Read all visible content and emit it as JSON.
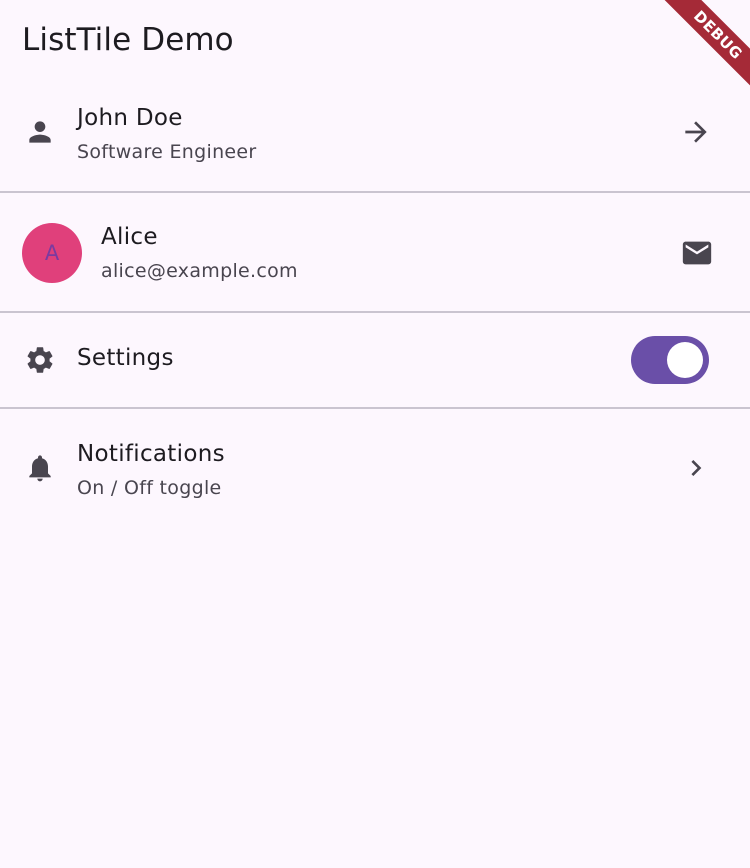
{
  "app_bar": {
    "title": "ListTile Demo",
    "debug_banner": "DEBUG"
  },
  "tiles": [
    {
      "leading_icon": "person-icon",
      "title": "John Doe",
      "subtitle": "Software Engineer",
      "trailing_icon": "arrow-forward-icon"
    },
    {
      "leading_avatar_letter": "A",
      "title": "Alice",
      "subtitle": "alice@example.com",
      "trailing_icon": "mail-icon"
    },
    {
      "leading_icon": "gear-icon",
      "title": "Settings",
      "switch_on": true
    },
    {
      "leading_icon": "bell-icon",
      "title": "Notifications",
      "subtitle": "On / Off toggle",
      "trailing_icon": "chevron-right-icon"
    }
  ],
  "colors": {
    "background": "#fdf7fe",
    "divider": "#cac4d0",
    "avatar": "#e0407b",
    "switch_track": "#6a4fa8",
    "debug_banner": "#a52a37",
    "icon": "#49454f"
  }
}
